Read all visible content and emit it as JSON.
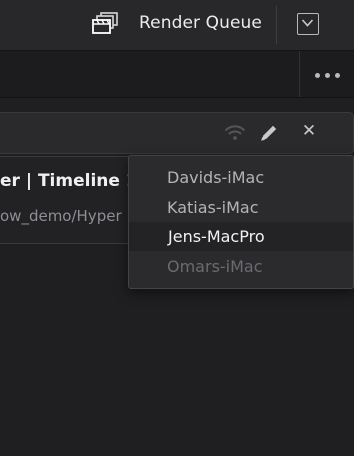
{
  "header": {
    "title": "Render Queue",
    "icon": "clapperboard-icon",
    "collapse_icon": "chevron-down-icon"
  },
  "toolbar": {
    "more_icon": "more-options-icon"
  },
  "job": {
    "title": "er | Timeline 1",
    "path": "ow_demo/Hyper",
    "status_icon": "wifi-icon",
    "edit_icon": "pencil-icon",
    "close_icon": "close-icon",
    "close_glyph": "✕"
  },
  "dropdown": {
    "items": [
      {
        "label": "Davids-iMac",
        "state": "normal"
      },
      {
        "label": "Katias-iMac",
        "state": "normal"
      },
      {
        "label": "Jens-MacPro",
        "state": "selected"
      },
      {
        "label": "Omars-iMac",
        "state": "disabled"
      }
    ]
  },
  "colors": {
    "background": "#1f1f22",
    "header": "#28282b",
    "dropdown": "#2b2b2e",
    "text_primary": "#ececec",
    "text_muted": "#8e8e93"
  }
}
